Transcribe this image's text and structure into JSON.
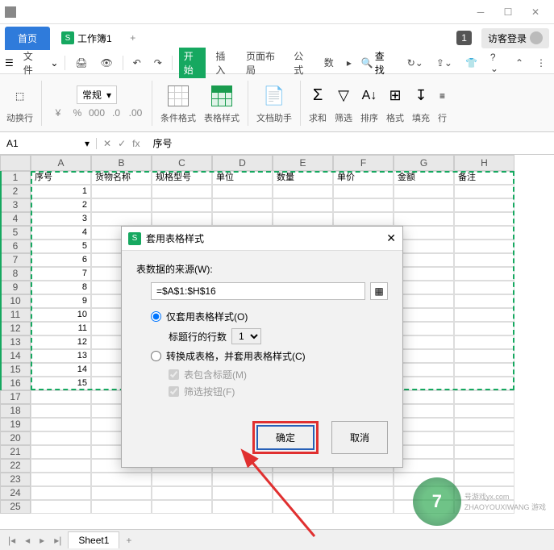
{
  "titlebar": {
    "badge": "1",
    "guest": "访客登录"
  },
  "tabs": {
    "home": "首页",
    "workbook": "工作簿1",
    "add": "+"
  },
  "menu": {
    "file": "文件",
    "items": [
      "开始",
      "插入",
      "页面布局",
      "公式",
      "数"
    ],
    "search": "查找"
  },
  "ribbon": {
    "format_combo": "常规",
    "cond_format": "条件格式",
    "table_style": "表格样式",
    "doc_assist": "文档助手",
    "sum": "求和",
    "filter": "筛选",
    "sort": "排序",
    "format": "格式",
    "fill": "填充",
    "row": "行",
    "wrap": "动换行"
  },
  "namebox": {
    "value": "A1",
    "fx": "fx",
    "formula": "序号"
  },
  "columns": [
    "A",
    "B",
    "C",
    "D",
    "E",
    "F",
    "G",
    "H"
  ],
  "headers": [
    "序号",
    "货物名称",
    "规格型号",
    "单位",
    "数量",
    "单价",
    "金额",
    "备注"
  ],
  "rows": [
    "1",
    "2",
    "3",
    "4",
    "5",
    "6",
    "7",
    "8",
    "9",
    "10",
    "11",
    "12",
    "13",
    "14",
    "15"
  ],
  "row_nums": [
    "1",
    "2",
    "3",
    "4",
    "5",
    "6",
    "7",
    "8",
    "9",
    "10",
    "11",
    "12",
    "13",
    "14",
    "15",
    "16",
    "17",
    "18",
    "19",
    "20",
    "21",
    "22",
    "23",
    "24",
    "25"
  ],
  "sheets": {
    "sheet1": "Sheet1",
    "add": "+"
  },
  "dialog": {
    "title": "套用表格样式",
    "source_label": "表数据的来源(W):",
    "range": "=$A$1:$H$16",
    "opt_style_only": "仅套用表格样式(O)",
    "header_rows_label": "标题行的行数",
    "header_rows_value": "1",
    "opt_convert": "转换成表格，并套用表格样式(C)",
    "check_has_header": "表包含标题(M)",
    "check_filter_btn": "筛选按钮(F)",
    "ok": "确定",
    "cancel": "取消"
  },
  "watermark": {
    "num": "7",
    "text1": "号游戏yx.com",
    "text2": "ZHAOYOUXIWANG 游戏"
  }
}
